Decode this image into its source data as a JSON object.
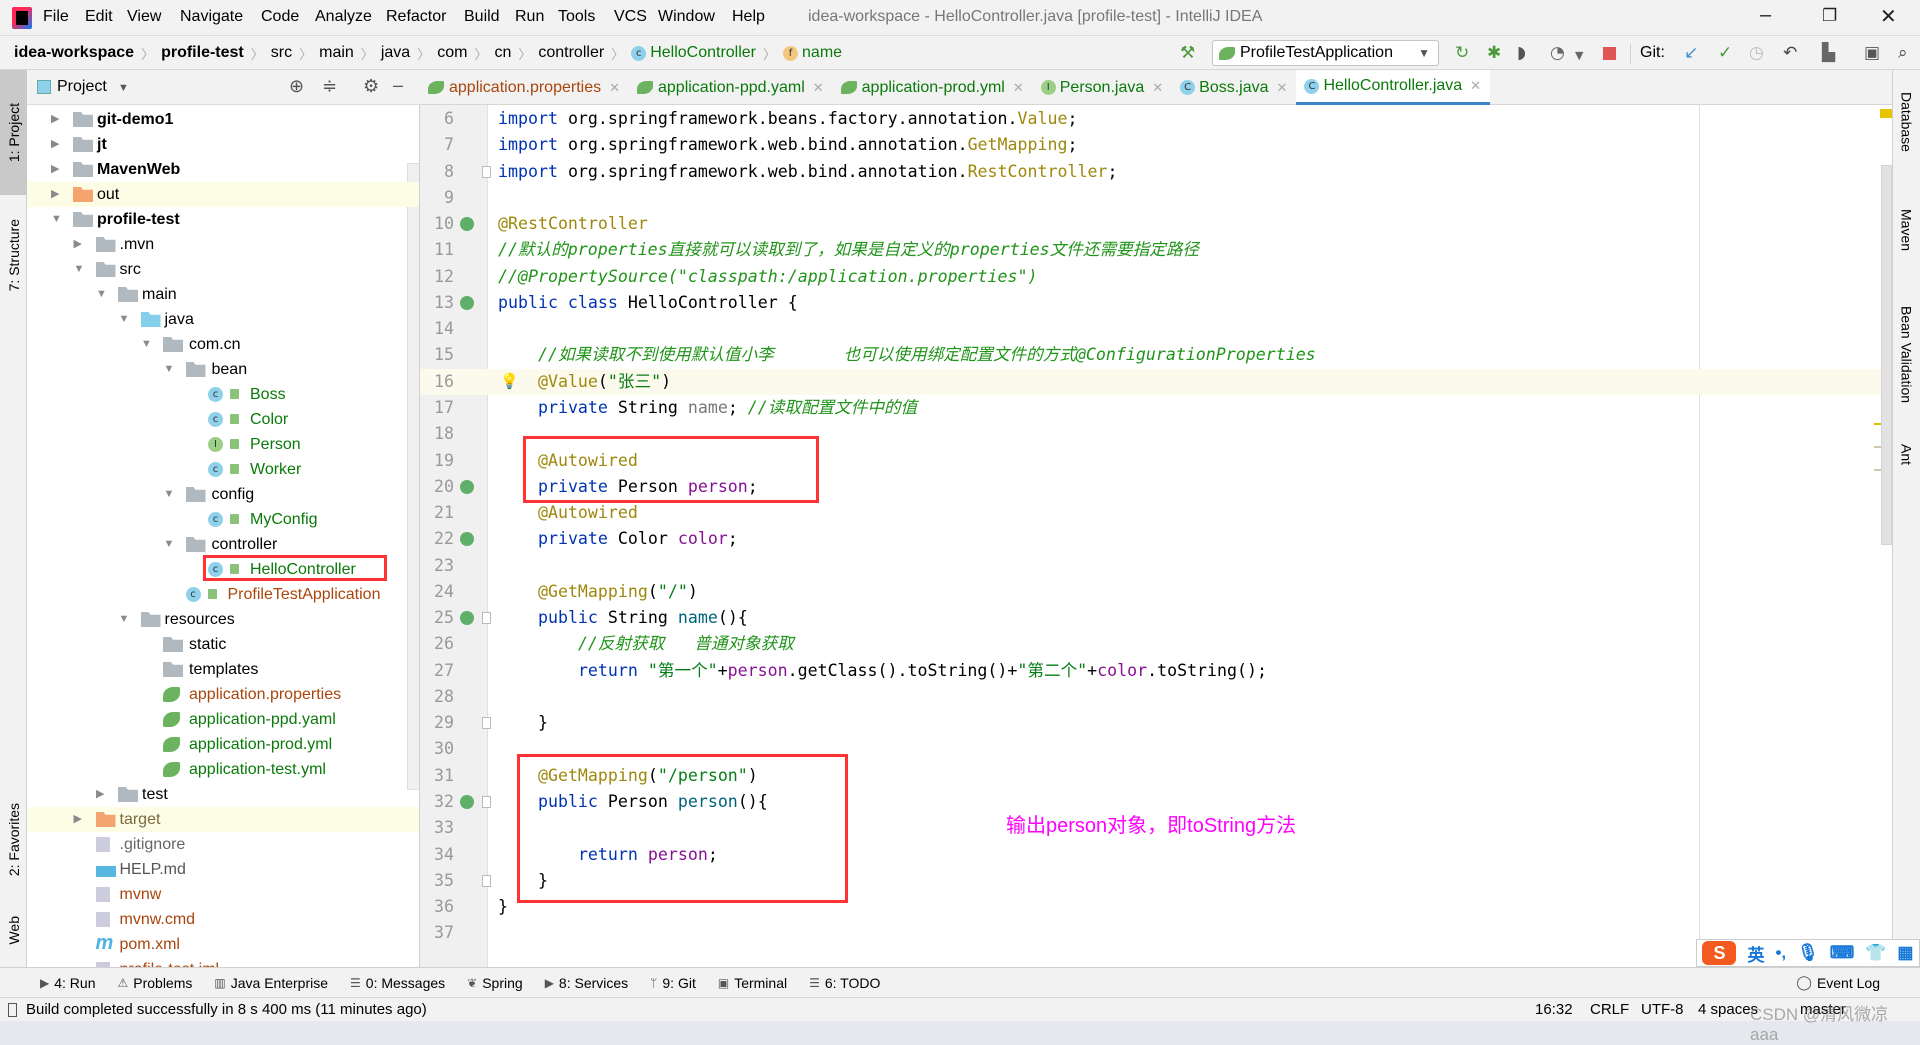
{
  "window": {
    "title": "idea-workspace - HelloController.java [profile-test] - IntelliJ IDEA",
    "menu": [
      "File",
      "Edit",
      "View",
      "Navigate",
      "Code",
      "Analyze",
      "Refactor",
      "Build",
      "Run",
      "Tools",
      "VCS",
      "Window",
      "Help"
    ],
    "controls": {
      "minimize": "–",
      "restore": "❐",
      "close": "✕"
    }
  },
  "breadcrumb": [
    {
      "label": "idea-workspace",
      "bold": true
    },
    {
      "label": "profile-test",
      "bold": true
    },
    {
      "label": "src"
    },
    {
      "label": "main"
    },
    {
      "label": "java"
    },
    {
      "label": "com"
    },
    {
      "label": "cn"
    },
    {
      "label": "controller"
    },
    {
      "label": "HelloController",
      "icon": "c",
      "color": "#0a7a0a"
    },
    {
      "label": "name",
      "icon": "f",
      "color": "#0a7a0a"
    }
  ],
  "toolbar": {
    "run_config": "ProfileTestApplication",
    "git_label": "Git:",
    "icons": [
      "hammer-icon",
      "rerun-icon",
      "debug-icon",
      "coverage-icon",
      "profiler-icon",
      "stop-icon",
      "git-update-icon",
      "git-commit-icon",
      "history-icon",
      "rollback-icon",
      "project-structure-icon",
      "presentation-icon",
      "search-icon"
    ]
  },
  "left_stripe": [
    "1: Project",
    "7: Structure",
    "2: Favorites",
    "Web"
  ],
  "right_stripe": [
    "Database",
    "Maven",
    "Bean Validation",
    "Ant"
  ],
  "project": {
    "title": "Project",
    "tree": [
      {
        "label": "git-demo1",
        "level": 0,
        "arrow": "right",
        "icon": "module",
        "bold": true
      },
      {
        "label": "jt",
        "level": 0,
        "arrow": "right",
        "icon": "module",
        "bold": true
      },
      {
        "label": "MavenWeb",
        "level": 0,
        "arrow": "right",
        "icon": "module",
        "bold": true
      },
      {
        "label": "out",
        "level": 0,
        "arrow": "right",
        "icon": "folder-orange",
        "ignored": true
      },
      {
        "label": "profile-test",
        "level": 0,
        "arrow": "down",
        "icon": "module",
        "bold": true
      },
      {
        "label": ".mvn",
        "level": 1,
        "arrow": "right",
        "icon": "folder"
      },
      {
        "label": "src",
        "level": 1,
        "arrow": "down",
        "icon": "folder"
      },
      {
        "label": "main",
        "level": 2,
        "arrow": "down",
        "icon": "folder"
      },
      {
        "label": "java",
        "level": 3,
        "arrow": "down",
        "icon": "folder-blue"
      },
      {
        "label": "com.cn",
        "level": 4,
        "arrow": "down",
        "icon": "package"
      },
      {
        "label": "bean",
        "level": 5,
        "arrow": "down",
        "icon": "package"
      },
      {
        "label": "Boss",
        "level": 6,
        "icon": "class",
        "color": "#0a7a0a"
      },
      {
        "label": "Color",
        "level": 6,
        "icon": "class",
        "color": "#0a7a0a"
      },
      {
        "label": "Person",
        "level": 6,
        "icon": "interface",
        "color": "#0a7a0a"
      },
      {
        "label": "Worker",
        "level": 6,
        "icon": "class",
        "color": "#0a7a0a"
      },
      {
        "label": "config",
        "level": 5,
        "arrow": "down",
        "icon": "package"
      },
      {
        "label": "MyConfig",
        "level": 6,
        "icon": "class",
        "color": "#0a7a0a"
      },
      {
        "label": "controller",
        "level": 5,
        "arrow": "down",
        "icon": "package"
      },
      {
        "label": "HelloController",
        "level": 6,
        "icon": "class",
        "color": "#0a7a0a"
      },
      {
        "label": "ProfileTestApplication",
        "level": 5,
        "icon": "spring-class",
        "color": "#a8460d"
      },
      {
        "label": "resources",
        "level": 3,
        "arrow": "down",
        "icon": "folder"
      },
      {
        "label": "static",
        "level": 4,
        "icon": "folder"
      },
      {
        "label": "templates",
        "level": 4,
        "icon": "folder"
      },
      {
        "label": "application.properties",
        "level": 4,
        "icon": "spring-config",
        "color": "#a8460d"
      },
      {
        "label": "application-ppd.yaml",
        "level": 4,
        "icon": "spring-config",
        "color": "#0a7a0a"
      },
      {
        "label": "application-prod.yml",
        "level": 4,
        "icon": "spring-config",
        "color": "#0a7a0a"
      },
      {
        "label": "application-test.yml",
        "level": 4,
        "icon": "spring-config",
        "color": "#0a7a0a"
      },
      {
        "label": "test",
        "level": 2,
        "arrow": "right",
        "icon": "folder"
      },
      {
        "label": "target",
        "level": 1,
        "arrow": "right",
        "icon": "folder-orange",
        "ignored": true,
        "color": "#7a6a3a"
      },
      {
        "label": ".gitignore",
        "level": 1,
        "icon": "file",
        "color": "#666666"
      },
      {
        "label": "HELP.md",
        "level": 1,
        "icon": "md-file",
        "color": "#555555"
      },
      {
        "label": "mvnw",
        "level": 1,
        "icon": "script-file",
        "color": "#a8460d"
      },
      {
        "label": "mvnw.cmd",
        "level": 1,
        "icon": "file",
        "color": "#a8460d"
      },
      {
        "label": "pom.xml",
        "level": 1,
        "icon": "maven-file",
        "color": "#a8460d"
      },
      {
        "label": "profile-test.iml",
        "level": 1,
        "icon": "file",
        "color": "#a8460d"
      }
    ]
  },
  "tabs": [
    {
      "label": "application.properties",
      "icon": "spring",
      "color": "#a8460d"
    },
    {
      "label": "application-ppd.yaml",
      "icon": "spring",
      "color": "#0a7a0a"
    },
    {
      "label": "application-prod.yml",
      "icon": "spring",
      "color": "#0a7a0a"
    },
    {
      "label": "Person.java",
      "icon": "I",
      "color": "#0a7a0a"
    },
    {
      "label": "Boss.java",
      "icon": "C",
      "color": "#0a7a0a"
    },
    {
      "label": "HelloController.java",
      "icon": "C",
      "color": "#0a7a0a",
      "active": true
    }
  ],
  "editor": {
    "current_line": 16,
    "bean_gutter_lines": [
      10,
      13,
      20,
      22,
      25,
      32
    ],
    "fold_lines": [
      8,
      25,
      29,
      32,
      35
    ],
    "lines": [
      {
        "n": 6,
        "t": [
          [
            "import",
            "kw"
          ],
          [
            " org.springframework.beans.factory.annotation.",
            ""
          ],
          [
            "Value",
            "an"
          ],
          [
            ";",
            ""
          ]
        ]
      },
      {
        "n": 7,
        "t": [
          [
            "import",
            "kw"
          ],
          [
            " org.springframework.web.bind.annotation.",
            ""
          ],
          [
            "GetMapping",
            "an"
          ],
          [
            ";",
            ""
          ]
        ]
      },
      {
        "n": 8,
        "t": [
          [
            "import",
            "kw"
          ],
          [
            " org.springframework.web.bind.annotation.",
            ""
          ],
          [
            "RestController",
            "an"
          ],
          [
            ";",
            ""
          ]
        ]
      },
      {
        "n": 9,
        "t": []
      },
      {
        "n": 10,
        "t": [
          [
            "@RestController",
            "an"
          ]
        ]
      },
      {
        "n": 11,
        "t": [
          [
            "//默认的properties直接就可以读取到了，如果是自定义的properties文件还需要指定路径",
            "cm"
          ]
        ]
      },
      {
        "n": 12,
        "t": [
          [
            "//@PropertySource(\"classpath:/application.properties\")",
            "cm"
          ]
        ]
      },
      {
        "n": 13,
        "t": [
          [
            "public class",
            "kw"
          ],
          [
            " HelloController {",
            ""
          ]
        ]
      },
      {
        "n": 14,
        "t": []
      },
      {
        "n": 15,
        "t": [
          [
            "    ",
            ""
          ],
          [
            "//如果读取不到使用默认值小李       也可以使用绑定配置文件的方式@ConfigurationProperties",
            "cm"
          ]
        ]
      },
      {
        "n": 16,
        "t": [
          [
            "    ",
            ""
          ],
          [
            "@Value",
            "an"
          ],
          [
            "(",
            ""
          ],
          [
            "\"张三\"",
            "st"
          ],
          [
            ")",
            ""
          ]
        ]
      },
      {
        "n": 17,
        "t": [
          [
            "    ",
            ""
          ],
          [
            "private",
            "kw"
          ],
          [
            " String ",
            ""
          ],
          [
            "name",
            "unused"
          ],
          [
            "; ",
            ""
          ],
          [
            "//读取配置文件中的值",
            "cm"
          ]
        ]
      },
      {
        "n": 18,
        "t": []
      },
      {
        "n": 19,
        "t": [
          [
            "    ",
            ""
          ],
          [
            "@Autowired",
            "an"
          ]
        ]
      },
      {
        "n": 20,
        "t": [
          [
            "    ",
            ""
          ],
          [
            "private",
            "kw"
          ],
          [
            " Person ",
            ""
          ],
          [
            "person",
            "fd"
          ],
          [
            ";",
            ""
          ]
        ]
      },
      {
        "n": 21,
        "t": [
          [
            "    ",
            ""
          ],
          [
            "@Autowired",
            "an"
          ]
        ]
      },
      {
        "n": 22,
        "t": [
          [
            "    ",
            ""
          ],
          [
            "private",
            "kw"
          ],
          [
            " Color ",
            ""
          ],
          [
            "color",
            "fd"
          ],
          [
            ";",
            ""
          ]
        ]
      },
      {
        "n": 23,
        "t": []
      },
      {
        "n": 24,
        "t": [
          [
            "    ",
            ""
          ],
          [
            "@GetMapping",
            "an"
          ],
          [
            "(",
            ""
          ],
          [
            "\"/\"",
            "st"
          ],
          [
            ")",
            ""
          ]
        ]
      },
      {
        "n": 25,
        "t": [
          [
            "    ",
            ""
          ],
          [
            "public",
            "kw"
          ],
          [
            " String ",
            ""
          ],
          [
            "name",
            "mth"
          ],
          [
            "(){",
            ""
          ]
        ]
      },
      {
        "n": 26,
        "t": [
          [
            "        ",
            ""
          ],
          [
            "//反射获取   普通对象获取",
            "cm"
          ]
        ]
      },
      {
        "n": 27,
        "t": [
          [
            "        ",
            ""
          ],
          [
            "return",
            "kw"
          ],
          [
            " ",
            ""
          ],
          [
            "\"第一个\"",
            "st"
          ],
          [
            "+",
            ""
          ],
          [
            "person",
            "fd"
          ],
          [
            ".getClass().toString()+",
            ""
          ],
          [
            "\"第二个\"",
            "st"
          ],
          [
            "+",
            ""
          ],
          [
            "color",
            "fd"
          ],
          [
            ".toString();",
            ""
          ]
        ]
      },
      {
        "n": 28,
        "t": []
      },
      {
        "n": 29,
        "t": [
          [
            "    }",
            ""
          ]
        ]
      },
      {
        "n": 30,
        "t": []
      },
      {
        "n": 31,
        "t": [
          [
            "    ",
            ""
          ],
          [
            "@GetMapping",
            "an"
          ],
          [
            "(",
            ""
          ],
          [
            "\"/person\"",
            "st"
          ],
          [
            ")",
            ""
          ]
        ]
      },
      {
        "n": 32,
        "t": [
          [
            "    ",
            ""
          ],
          [
            "public",
            "kw"
          ],
          [
            " Person ",
            ""
          ],
          [
            "person",
            "mth"
          ],
          [
            "(){",
            ""
          ]
        ]
      },
      {
        "n": 33,
        "t": []
      },
      {
        "n": 34,
        "t": [
          [
            "        ",
            ""
          ],
          [
            "return",
            "kw"
          ],
          [
            " ",
            ""
          ],
          [
            "person",
            "fd"
          ],
          [
            ";",
            ""
          ]
        ]
      },
      {
        "n": 35,
        "t": [
          [
            "    }",
            ""
          ]
        ]
      },
      {
        "n": 36,
        "t": [
          [
            "}",
            ""
          ]
        ]
      },
      {
        "n": 37,
        "t": []
      }
    ],
    "annotation": "输出person对象，即toString方法",
    "annotation_color": "#ff00ff",
    "highlight_color": "#ff3333"
  },
  "bottom_tools": [
    {
      "label": "4: Run",
      "icon": "▶"
    },
    {
      "label": "Problems",
      "icon": "⚠"
    },
    {
      "label": "Java Enterprise",
      "icon": "▥"
    },
    {
      "label": "0: Messages",
      "icon": "☰"
    },
    {
      "label": "Spring",
      "icon": "❦"
    },
    {
      "label": "8: Services",
      "icon": "▶"
    },
    {
      "label": "9: Git",
      "icon": "ᛘ"
    },
    {
      "label": "Terminal",
      "icon": "▣"
    },
    {
      "label": "6: TODO",
      "icon": "☰"
    }
  ],
  "event_log": "Event Log",
  "status": {
    "message": "Build completed successfully in 8 s 400 ms (11 minutes ago)",
    "position": "16:32",
    "line_sep": "CRLF",
    "encoding": "UTF-8",
    "indent": "4 spaces",
    "branch": "master"
  },
  "ime": {
    "lang": "英"
  },
  "watermark": "CSDN @清风微凉 aaa"
}
